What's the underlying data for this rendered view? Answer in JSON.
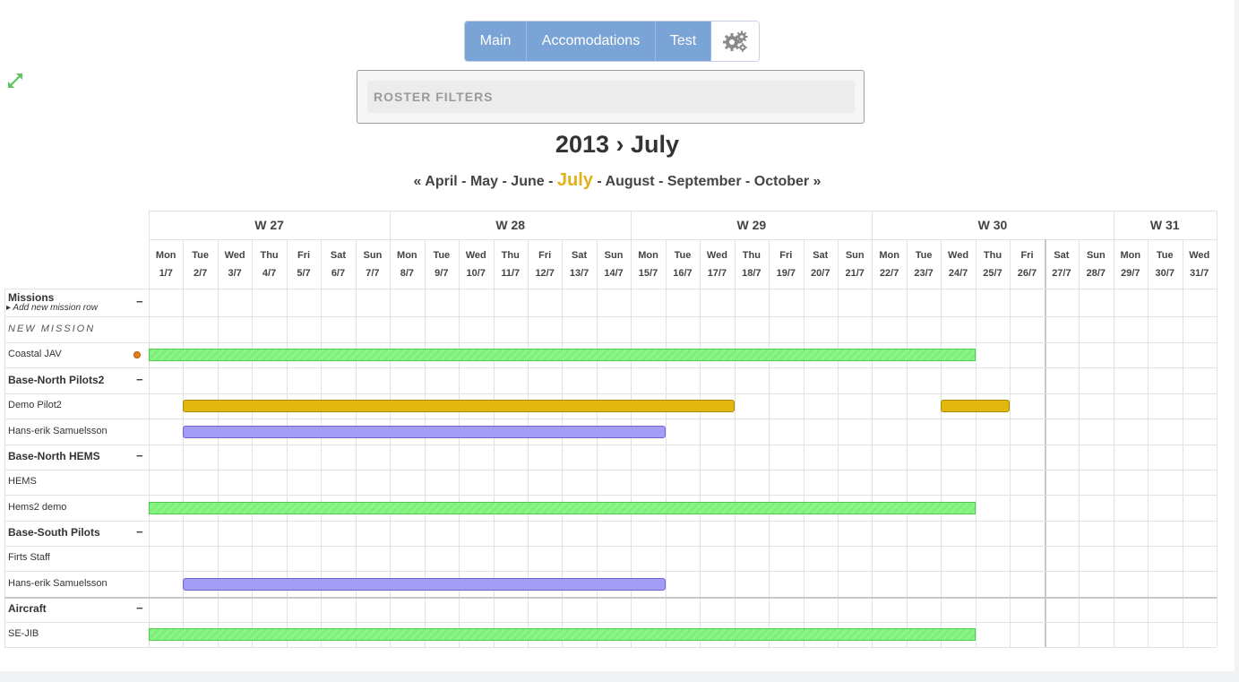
{
  "tabs": [
    "Main",
    "Accomodations",
    "Test"
  ],
  "icons": {
    "settings": "gears-icon",
    "expand": "expand-arrows-icon"
  },
  "filters": {
    "label": "ROSTER FILTERS"
  },
  "title": {
    "year": "2013",
    "sep": "›",
    "month": "July"
  },
  "month_nav": {
    "prev": "«",
    "months": [
      "April",
      "May",
      "June",
      "July",
      "August",
      "September",
      "October"
    ],
    "current": "July",
    "next": "»"
  },
  "weeks": [
    {
      "label": "W 27",
      "days": 7
    },
    {
      "label": "W 28",
      "days": 7
    },
    {
      "label": "W 29",
      "days": 7
    },
    {
      "label": "W 30",
      "days": 7
    },
    {
      "label": "W 31",
      "days": 3
    }
  ],
  "days": [
    [
      "Mon",
      "1/7"
    ],
    [
      "Tue",
      "2/7"
    ],
    [
      "Wed",
      "3/7"
    ],
    [
      "Thu",
      "4/7"
    ],
    [
      "Fri",
      "5/7"
    ],
    [
      "Sat",
      "6/7"
    ],
    [
      "Sun",
      "7/7"
    ],
    [
      "Mon",
      "8/7"
    ],
    [
      "Tue",
      "9/7"
    ],
    [
      "Wed",
      "10/7"
    ],
    [
      "Thu",
      "11/7"
    ],
    [
      "Fri",
      "12/7"
    ],
    [
      "Sat",
      "13/7"
    ],
    [
      "Sun",
      "14/7"
    ],
    [
      "Mon",
      "15/7"
    ],
    [
      "Tue",
      "16/7"
    ],
    [
      "Wed",
      "17/7"
    ],
    [
      "Thu",
      "18/7"
    ],
    [
      "Fri",
      "19/7"
    ],
    [
      "Sat",
      "20/7"
    ],
    [
      "Sun",
      "21/7"
    ],
    [
      "Mon",
      "22/7"
    ],
    [
      "Tue",
      "23/7"
    ],
    [
      "Wed",
      "24/7"
    ],
    [
      "Thu",
      "25/7"
    ],
    [
      "Fri",
      "26/7"
    ],
    [
      "Sat",
      "27/7"
    ],
    [
      "Sun",
      "28/7"
    ],
    [
      "Mon",
      "29/7"
    ],
    [
      "Tue",
      "30/7"
    ],
    [
      "Wed",
      "31/7"
    ]
  ],
  "rows": [
    {
      "type": "group",
      "label": "Missions",
      "add_label": "Add new mission row",
      "collapse": "−"
    },
    {
      "type": "newmission",
      "label": "NEW MISSION"
    },
    {
      "type": "item",
      "label": "Coastal JAV",
      "dot": true,
      "bars": [
        {
          "color": "green",
          "start": 1,
          "end": 24
        }
      ]
    },
    {
      "type": "group",
      "label": "Base-North Pilots2",
      "collapse": "−"
    },
    {
      "type": "item",
      "label": "Demo Pilot2",
      "bars": [
        {
          "color": "yellow",
          "start": 2,
          "end": 17
        },
        {
          "color": "yellow",
          "start": 24,
          "end": 25
        }
      ]
    },
    {
      "type": "item",
      "label": "Hans-erik Samuelsson",
      "bars": [
        {
          "color": "purple",
          "start": 2,
          "end": 15
        }
      ]
    },
    {
      "type": "group",
      "label": "Base-North HEMS",
      "collapse": "−"
    },
    {
      "type": "item",
      "label": "HEMS",
      "bars": []
    },
    {
      "type": "item",
      "label": "Hems2 demo",
      "bars": [
        {
          "color": "green",
          "start": 1,
          "end": 24
        }
      ]
    },
    {
      "type": "group",
      "label": "Base-South Pilots",
      "collapse": "−"
    },
    {
      "type": "item",
      "label": "Firts Staff",
      "bars": []
    },
    {
      "type": "item",
      "label": "Hans-erik Samuelsson",
      "bars": [
        {
          "color": "purple",
          "start": 2,
          "end": 15
        }
      ]
    },
    {
      "type": "group",
      "label": "Aircraft",
      "collapse": "−"
    },
    {
      "type": "item",
      "label": "SE-JIB",
      "bars": [
        {
          "color": "green",
          "start": 1,
          "end": 24
        }
      ]
    }
  ]
}
